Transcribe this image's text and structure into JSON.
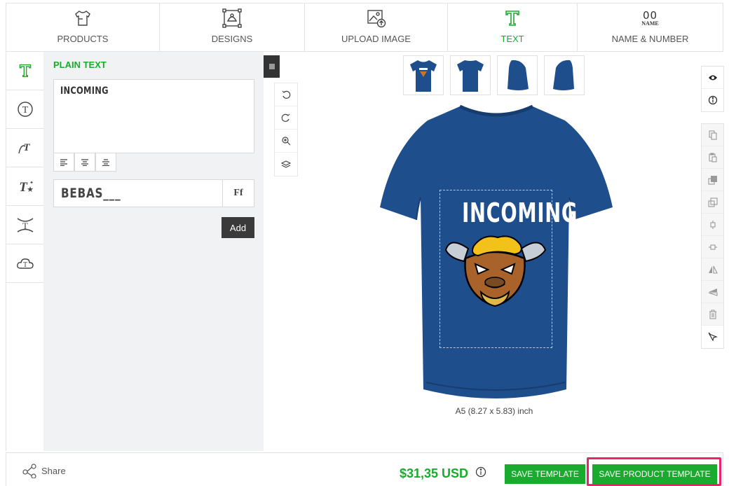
{
  "tabs": [
    {
      "label": "PRODUCTS",
      "icon": "tshirt-icon"
    },
    {
      "label": "DESIGNS",
      "icon": "designs-icon"
    },
    {
      "label": "UPLOAD IMAGE",
      "icon": "upload-image-icon"
    },
    {
      "label": "TEXT",
      "icon": "text-icon",
      "active": true
    },
    {
      "label": "NAME & NUMBER",
      "icon": "name-number-icon",
      "icon_text": "00",
      "icon_subtext": "NAME"
    }
  ],
  "side_icons": [
    "plain-text-icon",
    "circle-text-icon",
    "curved-text-icon",
    "effect-text-icon",
    "arc-text-icon",
    "cloud-text-icon"
  ],
  "text_panel": {
    "title": "PLAIN TEXT",
    "text_value": "INCOMING",
    "font_name": "BEBAS___",
    "font_button": "Ff",
    "add_label": "Add"
  },
  "design": {
    "shirt_text": "INCOMING",
    "print_size": "A5 (8.27 x 5.83) inch"
  },
  "colors": {
    "accent": "#1aab2e",
    "shirt": "#1f4e8c",
    "highlight": "#e6266a"
  },
  "footer": {
    "share_label": "Share",
    "price": "$31,35 USD",
    "save_template": "SAVE TEMPLATE",
    "save_product_template": "SAVE PRODUCT TEMPLATE"
  }
}
